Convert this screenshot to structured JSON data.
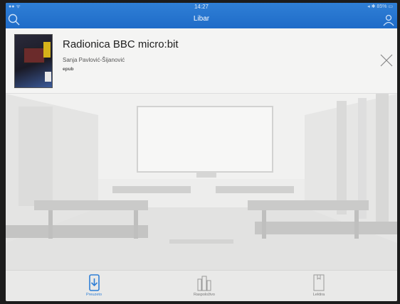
{
  "status": {
    "left": "●● ᯤ",
    "time": "14:27",
    "right": "◂ ✱ 85% ▭"
  },
  "app": {
    "title": "Libar"
  },
  "book": {
    "title": "Radionica BBC micro:bit",
    "author": "Sanja Pavlović-Šijanović",
    "format": "epub"
  },
  "tabs": [
    {
      "label": "Preuzeto",
      "icon": "download-icon",
      "active": true
    },
    {
      "label": "Raspoloživo",
      "icon": "bookshelf-icon",
      "active": false
    },
    {
      "label": "Lektira",
      "icon": "book-icon",
      "active": false
    }
  ],
  "colors": {
    "accent": "#2f7fd6",
    "background": "#f0f0ef"
  }
}
